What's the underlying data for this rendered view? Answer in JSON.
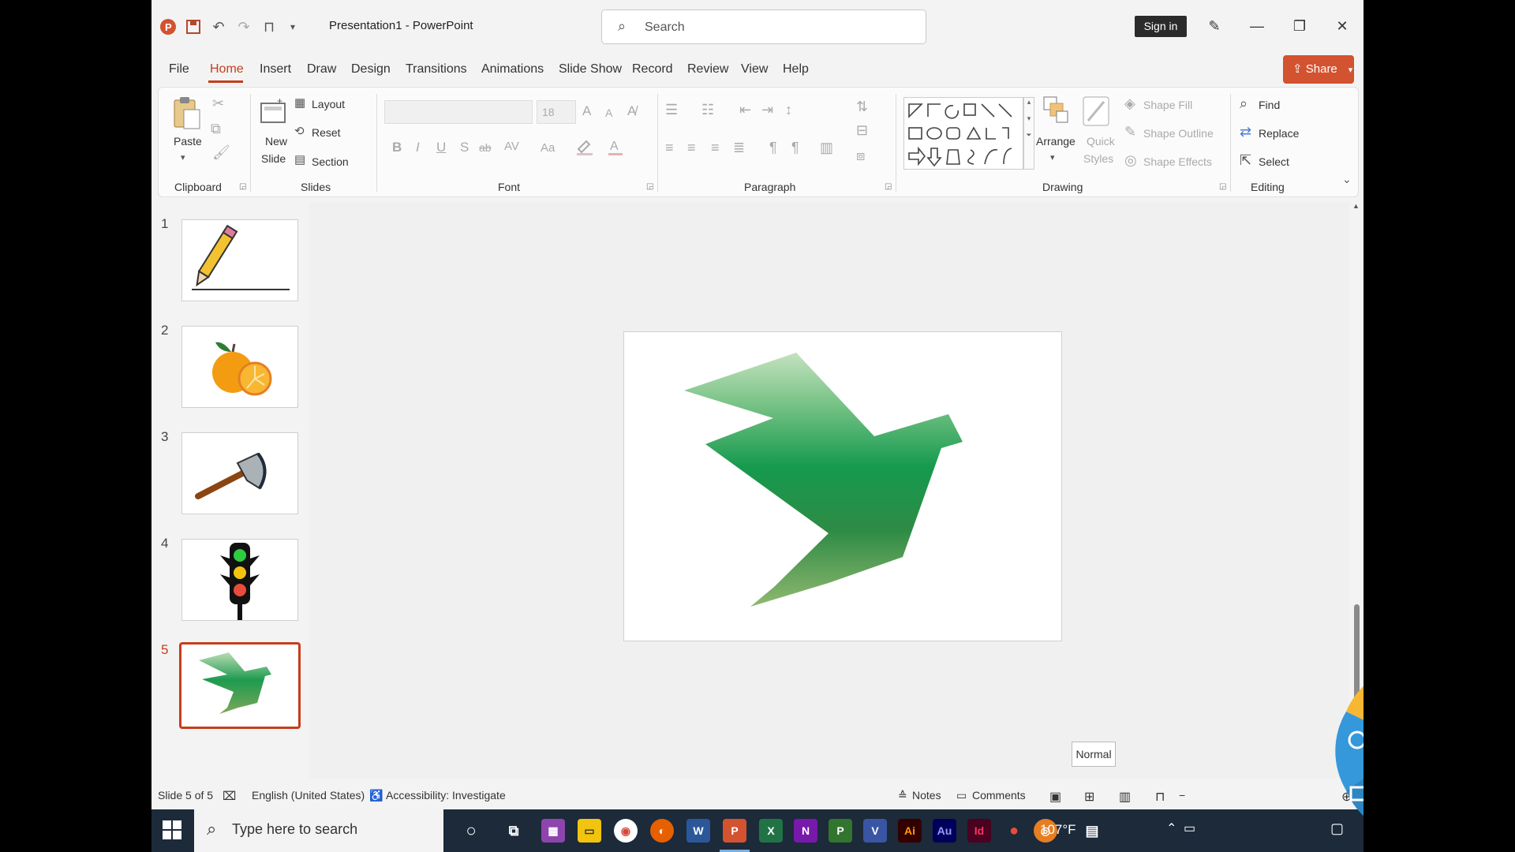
{
  "titlebar": {
    "title": "Presentation1 - PowerPoint",
    "search_placeholder": "Search",
    "signin": "Sign in"
  },
  "menu": {
    "tabs": [
      "File",
      "Home",
      "Insert",
      "Draw",
      "Design",
      "Transitions",
      "Animations",
      "Slide Show",
      "Record",
      "Review",
      "View",
      "Help"
    ],
    "share": "Share"
  },
  "ribbon": {
    "clipboard": {
      "label": "Clipboard",
      "paste": "Paste"
    },
    "slides": {
      "label": "Slides",
      "new_slide_1": "New",
      "new_slide_2": "Slide",
      "layout": "Layout",
      "reset": "Reset",
      "section": "Section"
    },
    "font": {
      "label": "Font",
      "size": "18",
      "bold": "B",
      "italic": "I",
      "underline": "U",
      "shadow": "S",
      "strike": "ab",
      "spacing": "AV",
      "case": "Aa",
      "grow": "A",
      "shrink": "A"
    },
    "paragraph": {
      "label": "Paragraph"
    },
    "drawing": {
      "label": "Drawing",
      "arrange": "Arrange",
      "quick_styles_1": "Quick",
      "quick_styles_2": "Styles",
      "shape_fill": "Shape Fill",
      "shape_outline": "Shape Outline",
      "shape_effects": "Shape Effects"
    },
    "editing": {
      "label": "Editing",
      "find": "Find",
      "replace": "Replace",
      "select": "Select"
    }
  },
  "thumbnails": [
    {
      "num": "1",
      "icon": "pencil"
    },
    {
      "num": "2",
      "icon": "orange"
    },
    {
      "num": "3",
      "icon": "axe"
    },
    {
      "num": "4",
      "icon": "traffic-light"
    },
    {
      "num": "5",
      "icon": "bird"
    }
  ],
  "status": {
    "slide_info": "Slide 5 of 5",
    "language": "English (United States)",
    "accessibility": "Accessibility: Investigate",
    "notes": "Notes",
    "comments": "Comments",
    "tooltip": "Normal"
  },
  "taskbar": {
    "search_placeholder": "Type here to search",
    "temperature": "107°F",
    "apps": [
      "Cortana",
      "Task View",
      "WinRAR",
      "File Explorer",
      "Chrome",
      "Firefox",
      "Word",
      "PowerPoint",
      "Excel",
      "OneNote",
      "Project",
      "Visio",
      "Illustrator",
      "Audition",
      "InDesign",
      "Maps",
      "Screen Recorder"
    ]
  },
  "colors": {
    "accent": "#c43e1c",
    "share": "#d35230",
    "bird_top": "#b9dcb3",
    "bird_mid": "#1e9a4f",
    "bird_bottom": "#7da85a"
  }
}
